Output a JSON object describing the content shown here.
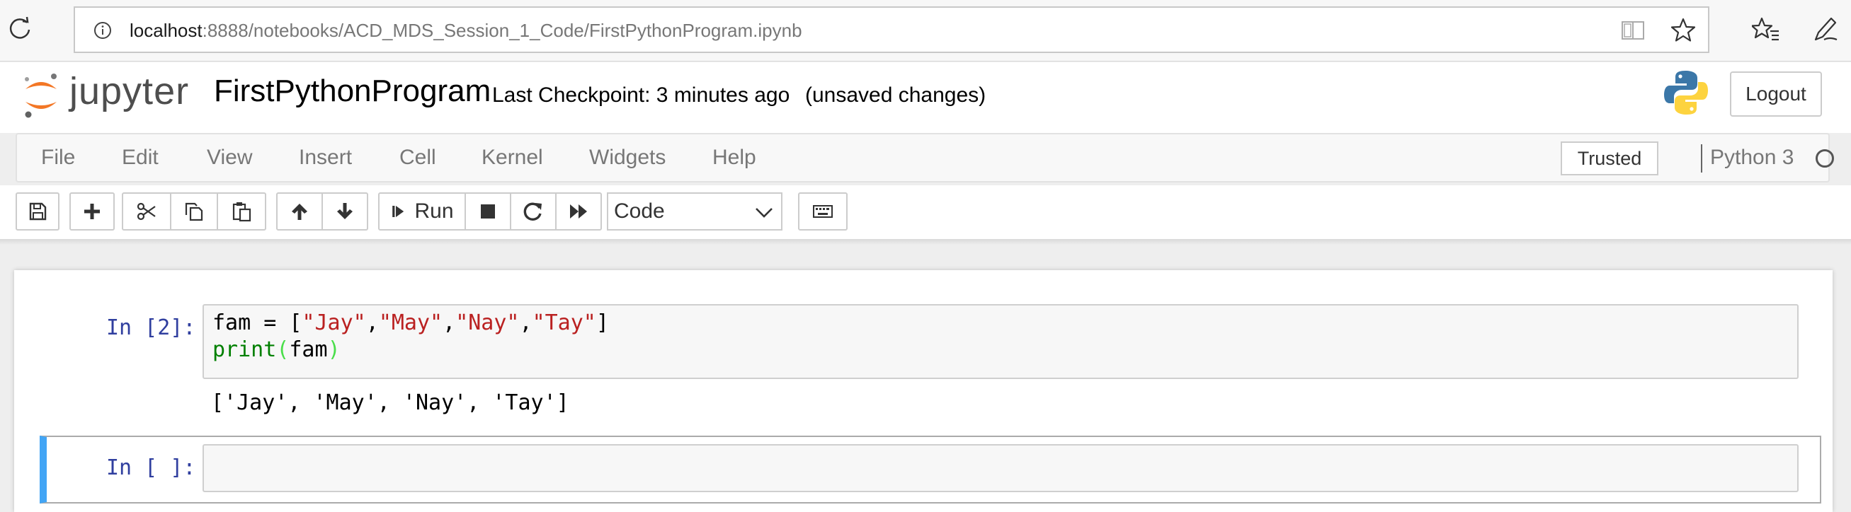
{
  "browser": {
    "url_host": "localhost",
    "url_rest": ":8888/notebooks/ACD_MDS_Session_1_Code/FirstPythonProgram.ipynb"
  },
  "header": {
    "logo_text": "jupyter",
    "notebook_name": "FirstPythonProgram",
    "checkpoint": "Last Checkpoint: 3 minutes ago",
    "status": "(unsaved changes)",
    "logout_label": "Logout"
  },
  "menubar": {
    "items": [
      "File",
      "Edit",
      "View",
      "Insert",
      "Cell",
      "Kernel",
      "Widgets",
      "Help"
    ],
    "trusted_label": "Trusted",
    "kernel_name": "Python 3"
  },
  "toolbar": {
    "run_label": "Run",
    "cell_type": "Code"
  },
  "cells": [
    {
      "prompt": "In [2]:",
      "code_line1": {
        "a": "fam = [",
        "s1": "\"Jay\"",
        "c1": ",",
        "s2": "\"May\"",
        "c2": ",",
        "s3": "\"Nay\"",
        "c3": ",",
        "s4": "\"Tay\"",
        "b": "]"
      },
      "code_line2": {
        "fn": "print",
        "open": "(",
        "arg": "fam",
        "close": ")"
      },
      "output": "['Jay', 'May', 'Nay', 'Tay']"
    },
    {
      "prompt": "In [ ]:"
    }
  ],
  "colors": {
    "prompt": "#303f9f",
    "string": "#ba2121",
    "builtin": "#008000",
    "selected_cell_bar": "#42a5f5",
    "logo_orange": "#f37726"
  }
}
